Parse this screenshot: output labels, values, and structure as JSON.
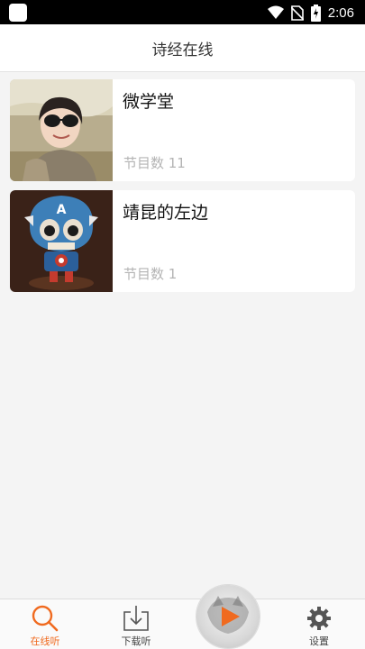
{
  "status_bar": {
    "time": "2:06"
  },
  "header": {
    "title": "诗经在线"
  },
  "cards": [
    {
      "title": "微学堂",
      "meta": "节目数 11"
    },
    {
      "title": "靖昆的左边",
      "meta": "节目数 1"
    }
  ],
  "tabs": {
    "online": "在线听",
    "download": "下载听",
    "settings": "设置"
  },
  "colors": {
    "accent": "#f06a1f",
    "background": "#f4f4f4"
  },
  "icons": [
    "wifi-icon",
    "no-sim-icon",
    "battery-charging-icon",
    "search-icon",
    "download-icon",
    "play-icon",
    "gear-icon"
  ]
}
